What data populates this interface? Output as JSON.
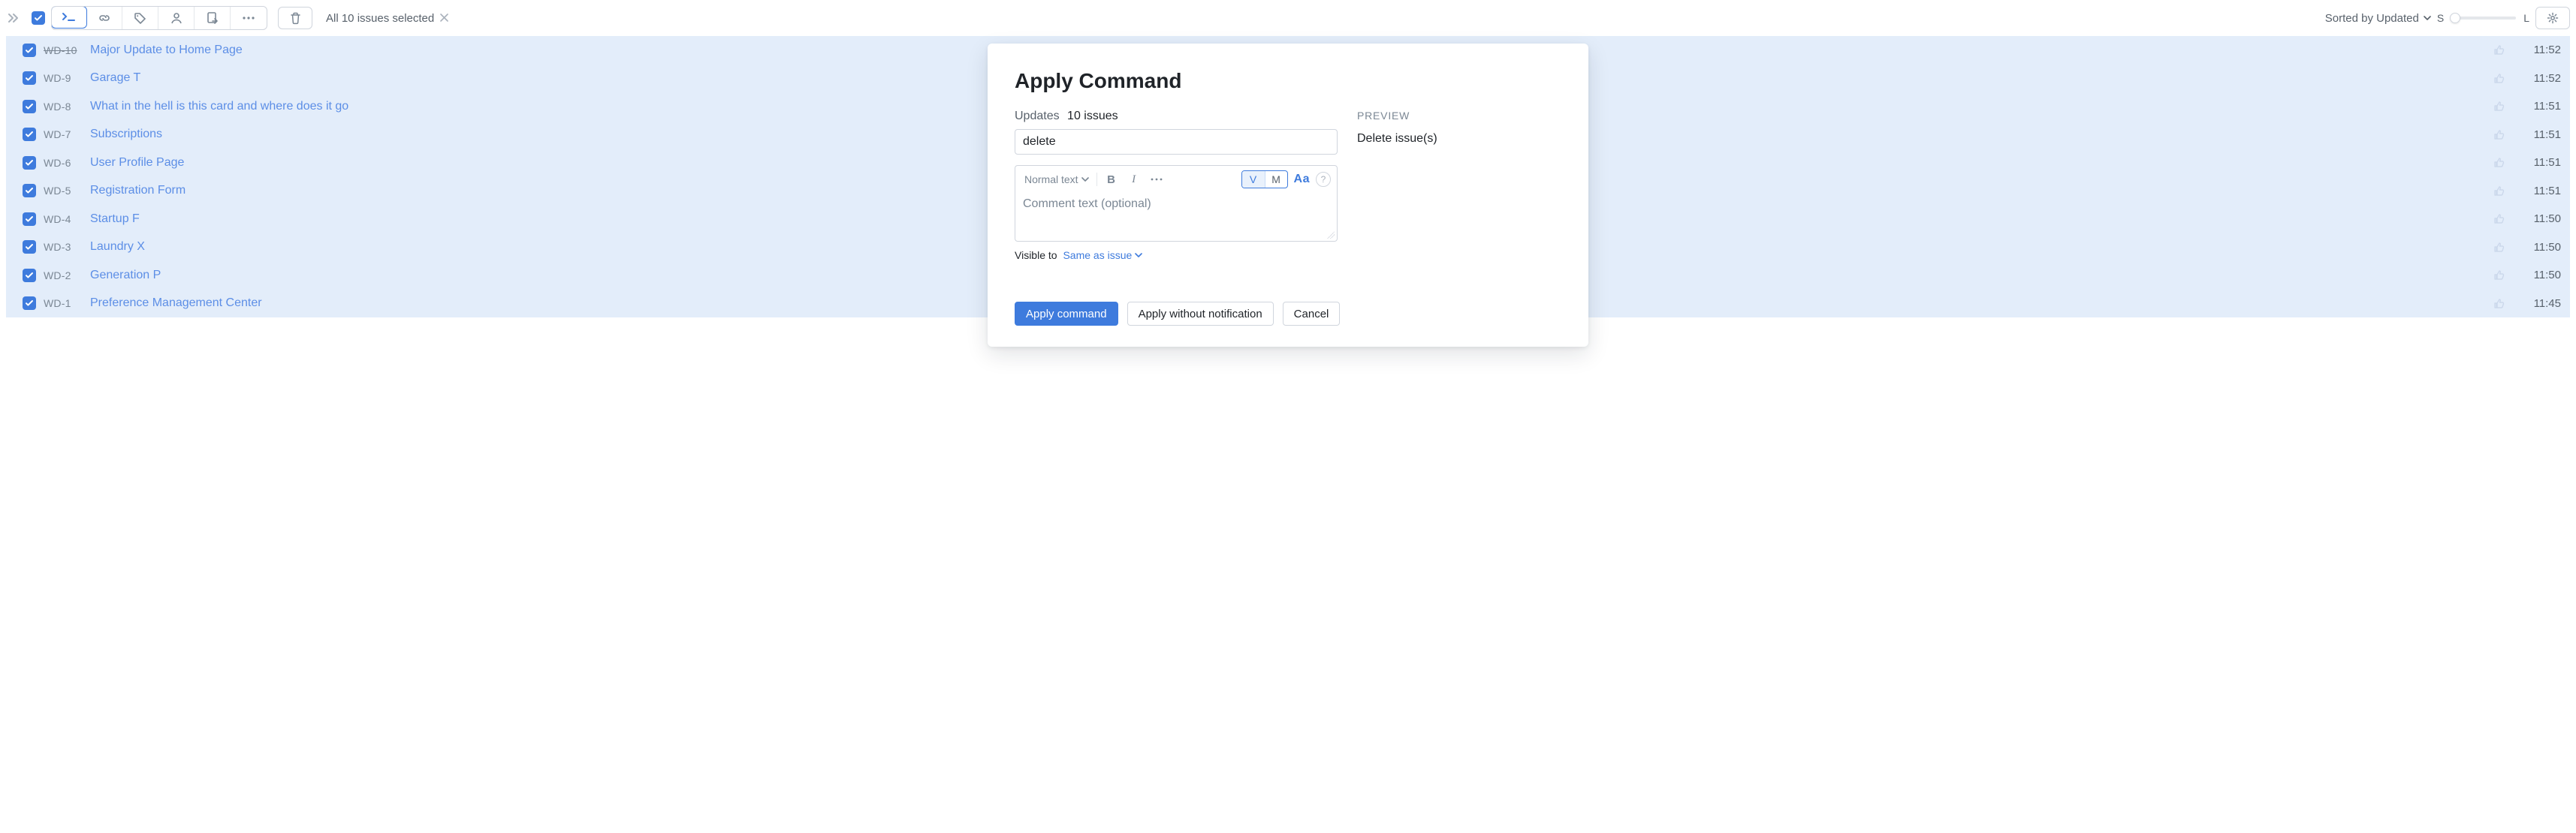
{
  "toolbar": {
    "selection_text": "All 10 issues selected",
    "sort_label": "Sorted by Updated",
    "size_small_label": "S",
    "size_large_label": "L"
  },
  "issues": [
    {
      "id": "WD-10",
      "title": "Major Update to Home Page",
      "time": "11:52",
      "strike": true
    },
    {
      "id": "WD-9",
      "title": "Garage T",
      "time": "11:52",
      "strike": false
    },
    {
      "id": "WD-8",
      "title": "What in the hell is this card and where does it go",
      "time": "11:51",
      "strike": false
    },
    {
      "id": "WD-7",
      "title": "Subscriptions",
      "time": "11:51",
      "strike": false
    },
    {
      "id": "WD-6",
      "title": "User Profile Page",
      "time": "11:51",
      "strike": false
    },
    {
      "id": "WD-5",
      "title": "Registration Form",
      "time": "11:51",
      "strike": false
    },
    {
      "id": "WD-4",
      "title": "Startup F",
      "time": "11:50",
      "strike": false
    },
    {
      "id": "WD-3",
      "title": "Laundry X",
      "time": "11:50",
      "strike": false
    },
    {
      "id": "WD-2",
      "title": "Generation P",
      "time": "11:50",
      "strike": false
    },
    {
      "id": "WD-1",
      "title": "Preference Management Center",
      "time": "11:45",
      "strike": false
    }
  ],
  "modal": {
    "title": "Apply Command",
    "updates_label": "Updates",
    "updates_count": "10 issues",
    "command_value": "delete",
    "editor": {
      "style_label": "Normal text",
      "placeholder": "Comment text (optional)",
      "view_mode_v": "V",
      "view_mode_m": "M",
      "aa_label": "Aa"
    },
    "visible_label": "Visible to",
    "visible_value": "Same as issue",
    "preview_heading": "PREVIEW",
    "preview_text": "Delete issue(s)",
    "apply_label": "Apply command",
    "apply_silent_label": "Apply without notification",
    "cancel_label": "Cancel"
  }
}
